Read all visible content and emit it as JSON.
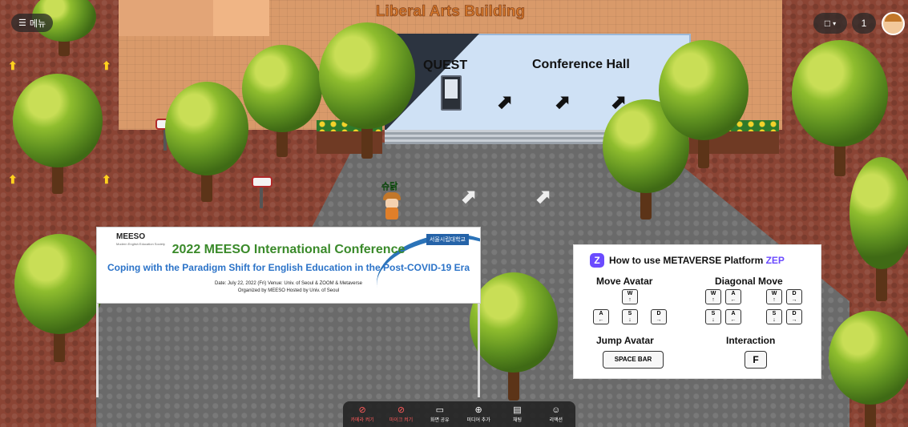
{
  "menu": {
    "label": "메뉴",
    "icon": "hamburger-icon"
  },
  "scene": {
    "building_title": "Liberal Arts Building",
    "quest_label": "QUEST",
    "hall_label": "Conference Hall",
    "avatar_name": "슈닭"
  },
  "banner": {
    "logo": "MEESO",
    "logo_sub": "Modern English Education Society",
    "university": "서울시립대학교",
    "title": "2022 MEESO International Conference",
    "subtitle": "Coping with the Paradigm Shift for English Education in the Post-COVID-19 Era",
    "line1": "Date: July 22, 2022 (Fri)    Venue: Univ. of Seoul & ZOOM & Metaverse",
    "line2": "Organized by MEESO    Hosted by Univ. of Seoul"
  },
  "guide": {
    "logo_letter": "Z",
    "title_prefix": "How to use METAVERSE Platform ",
    "title_brand": "ZEP",
    "move_avatar": "Move Avatar",
    "diagonal_move": "Diagonal Move",
    "jump_avatar": "Jump Avatar",
    "interaction": "Interaction",
    "space_bar": "SPACE BAR",
    "f_key": "F",
    "keys": {
      "w": "W",
      "a": "A",
      "s": "S",
      "d": "D"
    }
  },
  "top_right": {
    "view_icon": "square-icon",
    "dropdown_icon": "caret-down-icon",
    "player_count": "1",
    "profile_icon": "avatar-icon"
  },
  "toolbar": {
    "items": [
      {
        "label": "카메라 켜기",
        "icon": "camera-off-icon",
        "state": "off"
      },
      {
        "label": "마이크 켜기",
        "icon": "mic-off-icon",
        "state": "off"
      },
      {
        "label": "화면 공유",
        "icon": "screen-share-icon",
        "state": "on"
      },
      {
        "label": "미디어 추가",
        "icon": "plus-circle-icon",
        "state": "on"
      },
      {
        "label": "채팅",
        "icon": "chat-icon",
        "state": "on"
      },
      {
        "label": "리액션",
        "icon": "smile-icon",
        "state": "on"
      }
    ]
  }
}
